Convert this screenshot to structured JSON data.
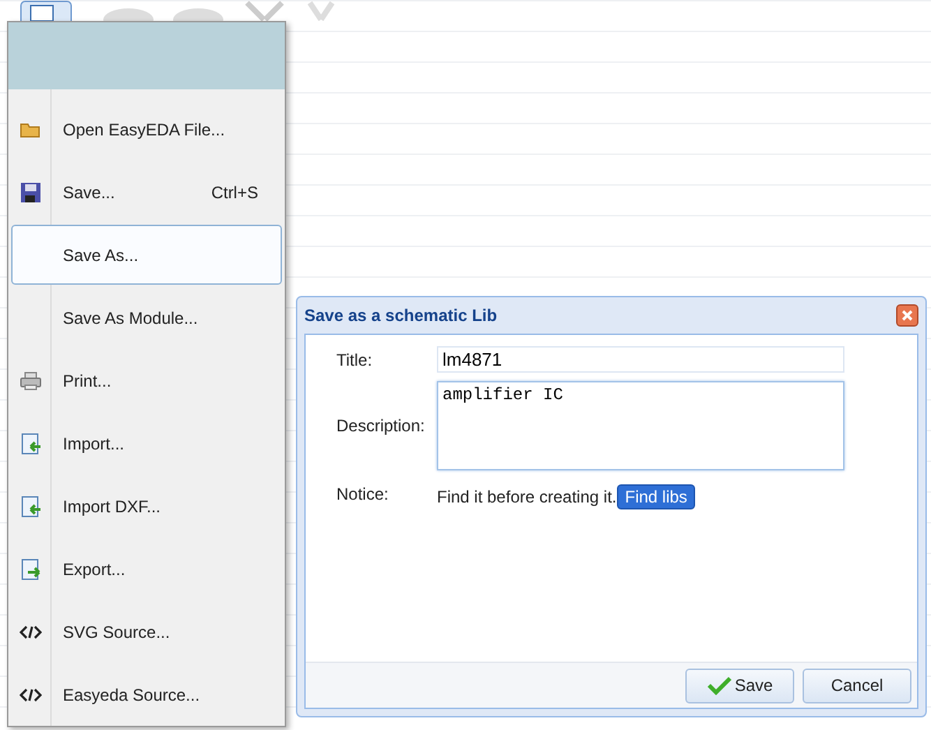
{
  "menu": {
    "items": [
      {
        "label": "Open EasyEDA File...",
        "selected": false
      },
      {
        "label": "Save...",
        "shortcut": "Ctrl+S",
        "selected": false
      },
      {
        "label": "Save As...",
        "selected": true
      },
      {
        "label": "Save As Module...",
        "selected": false
      },
      {
        "label": "Print...",
        "selected": false
      },
      {
        "label": "Import...",
        "selected": false
      },
      {
        "label": "Import DXF...",
        "selected": false
      },
      {
        "label": "Export...",
        "selected": false
      },
      {
        "label": "SVG Source...",
        "selected": false
      },
      {
        "label": "Easyeda Source...",
        "selected": false
      }
    ]
  },
  "dialog": {
    "title": "Save as a schematic Lib",
    "fields": [
      {
        "label": "Title:",
        "value": "lm4871"
      },
      {
        "label": "Description:",
        "value": "amplifier IC"
      }
    ],
    "notice": {
      "label": "Notice:",
      "text": "Find it before creating it.",
      "button": "Find libs"
    },
    "buttons": [
      "Save",
      "Cancel"
    ]
  }
}
